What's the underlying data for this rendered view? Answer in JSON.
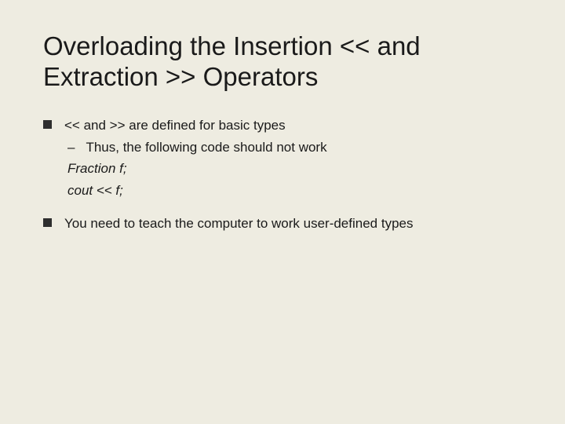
{
  "slide": {
    "title": "Overloading the Insertion << and Extraction >> Operators",
    "bullets": [
      {
        "text": "<< and >> are defined for basic types",
        "sub": [
          "Thus, the following code should not work"
        ],
        "code": [
          "Fraction f;",
          "cout << f;"
        ]
      },
      {
        "text": "You need to teach the computer to work user-defined types",
        "sub": [],
        "code": []
      }
    ],
    "dash": "–"
  }
}
